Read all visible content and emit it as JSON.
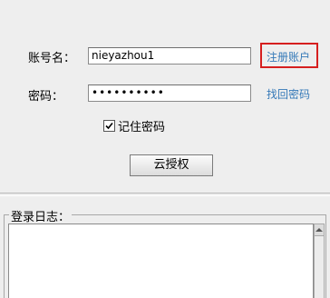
{
  "login": {
    "account_label": "账号名：",
    "account_value": "nieyazhou1",
    "register_link": "注册账户",
    "password_label": "密码：",
    "password_value": "••••••••••",
    "forgot_link": "找回密码",
    "remember_label": "记住密码",
    "remember_checked": true,
    "cloud_auth_button": "云授权"
  },
  "log": {
    "title": "登录日志：",
    "content": ""
  },
  "colors": {
    "link": "#3579b8",
    "highlight_border": "#d61f1f",
    "background": "#eeeeee"
  }
}
